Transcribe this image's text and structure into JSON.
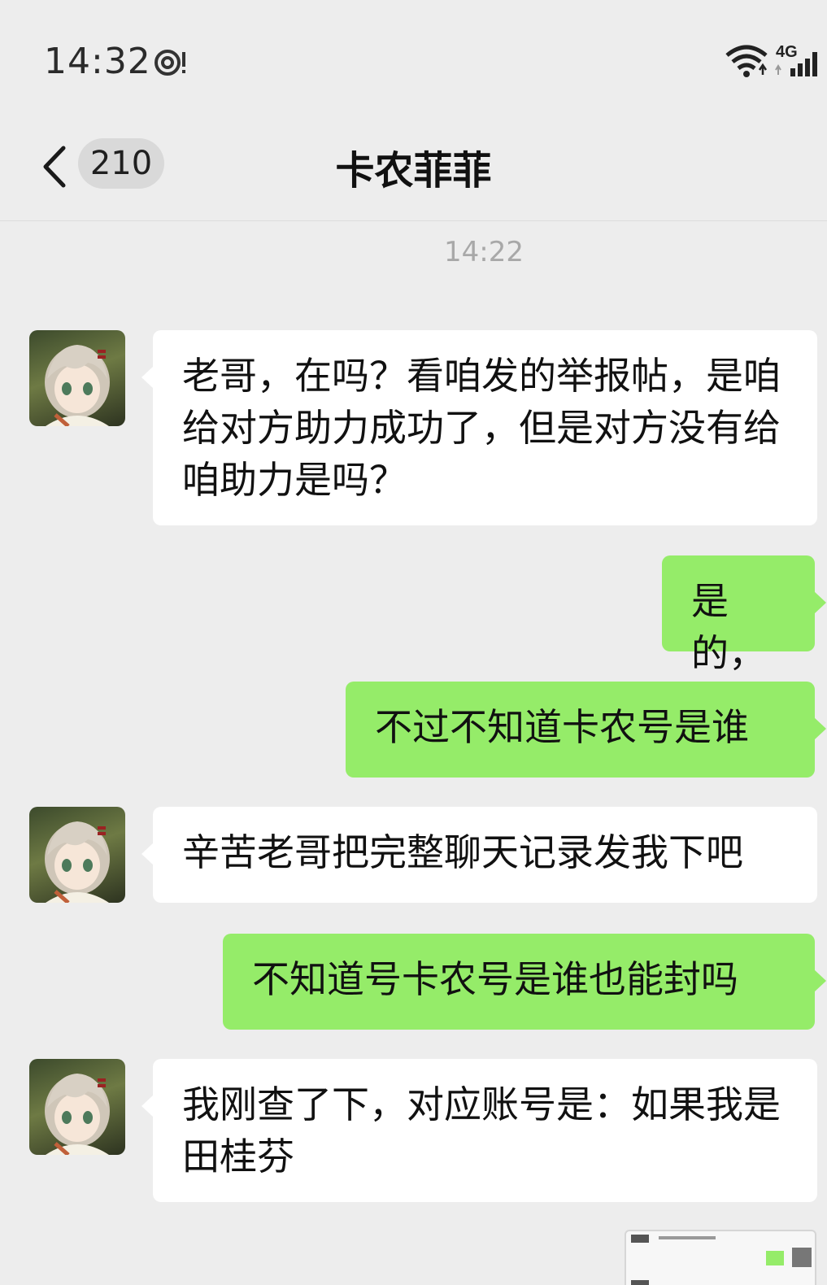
{
  "status_bar": {
    "time": "14:32",
    "network": "4G",
    "icons": [
      "eye-notification-icon",
      "wifi-icon",
      "cellular-signal-icon"
    ]
  },
  "header": {
    "unread_count": "210",
    "title": "卡农菲菲"
  },
  "timestamp": "14:22",
  "messages": [
    {
      "side": "in",
      "text": "老哥，在吗？看咱发的举报帖，是咱给对方助力成功了，但是对方没有给咱助力是吗？"
    },
    {
      "side": "out",
      "text": "是的，"
    },
    {
      "side": "out",
      "text": "不过不知道卡农号是谁"
    },
    {
      "side": "in",
      "text": "辛苦老哥把完整聊天记录发我下吧"
    },
    {
      "side": "out",
      "text": "不知道号卡农号是谁也能封吗"
    },
    {
      "side": "in",
      "text": "我刚查了下，对应账号是：如果我是田桂芬"
    }
  ],
  "colors": {
    "background": "#ededed",
    "incoming_bubble": "#ffffff",
    "outgoing_bubble": "#95ec69",
    "timestamp": "#a8a8a8"
  }
}
